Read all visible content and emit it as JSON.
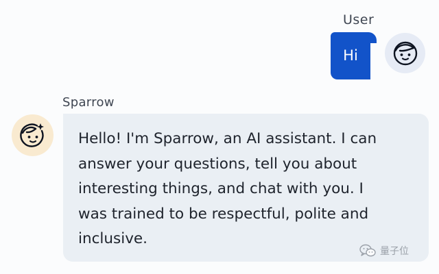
{
  "user": {
    "name": "User",
    "message": "Hi"
  },
  "bot": {
    "name": "Sparrow",
    "message": "Hello! I'm Sparrow, an AI assistant. I can answer your questions, tell you about interesting things, and chat with you. I was trained to be respectful, polite and inclusive."
  },
  "watermark": {
    "text": "量子位",
    "icon": "wechat-icon"
  },
  "colors": {
    "user_bubble": "#1253c9",
    "bot_bubble": "#eaeff4",
    "user_avatar_bg": "#e6ebf5",
    "bot_avatar_bg": "#f9ead0"
  }
}
